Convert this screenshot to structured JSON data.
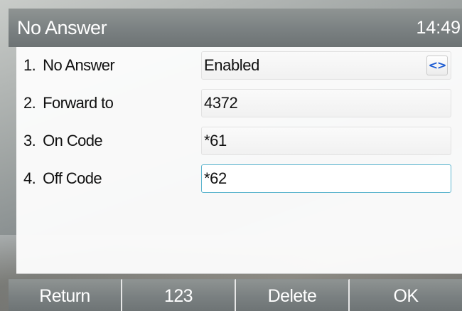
{
  "header": {
    "title": "No Answer",
    "time": "14:49"
  },
  "form": {
    "rows": [
      {
        "number": "1.",
        "label": "No Answer",
        "value": "Enabled",
        "control": "switch-arrows"
      },
      {
        "number": "2.",
        "label": "Forward to",
        "value": "4372"
      },
      {
        "number": "3.",
        "label": "On Code",
        "value": "*61"
      },
      {
        "number": "4.",
        "label": "Off Code",
        "value": "*62",
        "focused": true
      }
    ],
    "switch_glyph": "<>"
  },
  "softkeys": {
    "return_label": "Return",
    "input_mode_label": "123",
    "delete_label": "Delete",
    "ok_label": "OK"
  },
  "colors": {
    "focus_border": "#5fb6cf",
    "switch_arrow": "#1a5ad2",
    "header_bg": "#7c8283"
  }
}
